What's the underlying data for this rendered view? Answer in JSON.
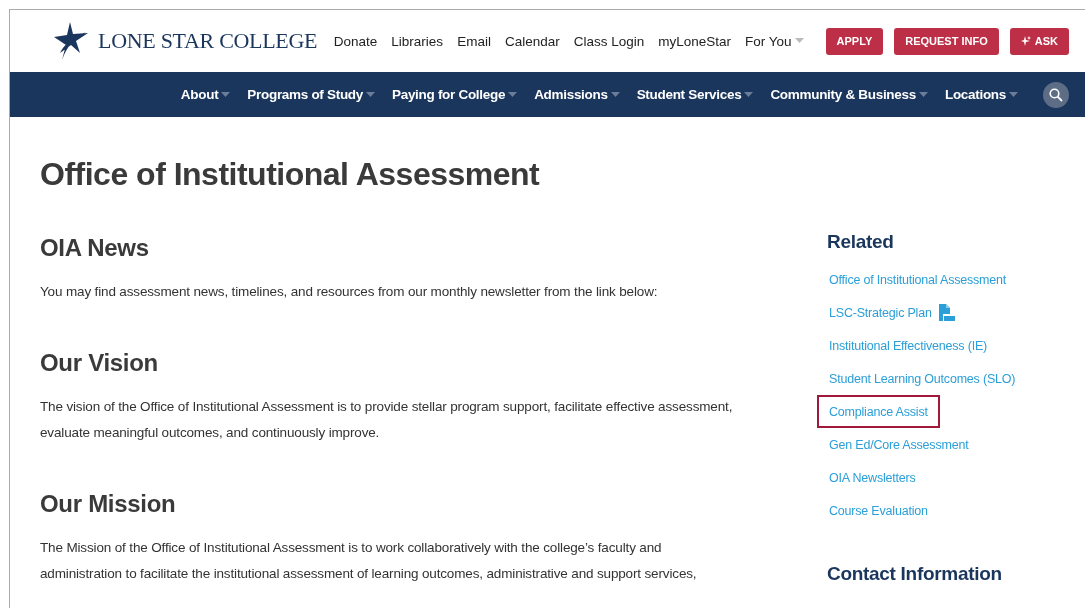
{
  "logo": {
    "text": "LONE STAR COLLEGE"
  },
  "utility_links": [
    {
      "label": "Donate",
      "has_menu": false
    },
    {
      "label": "Libraries",
      "has_menu": false
    },
    {
      "label": "Email",
      "has_menu": false
    },
    {
      "label": "Calendar",
      "has_menu": false
    },
    {
      "label": "Class Login",
      "has_menu": false
    },
    {
      "label": "myLoneStar",
      "has_menu": false
    },
    {
      "label": "For You",
      "has_menu": true
    }
  ],
  "action_buttons": [
    {
      "label": "APPLY",
      "kind": "plain"
    },
    {
      "label": "REQUEST INFO",
      "kind": "plain"
    },
    {
      "label": "ASK",
      "kind": "sparkle"
    }
  ],
  "main_nav": [
    {
      "label": "About",
      "has_menu": true
    },
    {
      "label": "Programs of Study",
      "has_menu": true
    },
    {
      "label": "Paying for College",
      "has_menu": true
    },
    {
      "label": "Admissions",
      "has_menu": true
    },
    {
      "label": "Student Services",
      "has_menu": true
    },
    {
      "label": "Community & Business",
      "has_menu": true
    },
    {
      "label": "Locations",
      "has_menu": true
    }
  ],
  "page_title": "Office of Institutional Assessment",
  "sections": [
    {
      "heading": "OIA News",
      "paragraphs": [
        "You may find assessment news, timelines, and resources from our monthly newsletter from the link below:"
      ]
    },
    {
      "heading": "Our Vision",
      "paragraphs": [
        "The vision of the Office of Institutional Assessment is to provide stellar program support, facilitate effective assessment, evaluate meaningful outcomes, and continuously improve."
      ]
    },
    {
      "heading": "Our Mission",
      "paragraphs": [
        "The Mission of the Office of Institutional Assessment is to work collaboratively with the college’s faculty and administration to facilitate the institutional assessment of learning outcomes, administrative and support services,"
      ]
    }
  ],
  "sidebar": {
    "heading": "Related",
    "links": [
      {
        "label": "Office of Institutional Assessment",
        "pdf": false,
        "highlighted": false
      },
      {
        "label": "LSC-Strategic Plan",
        "pdf": true,
        "highlighted": false
      },
      {
        "label": "Institutional Effectiveness (IE)",
        "pdf": false,
        "highlighted": false
      },
      {
        "label": "Student Learning Outcomes (SLO)",
        "pdf": false,
        "highlighted": false
      },
      {
        "label": "Compliance Assist",
        "pdf": false,
        "highlighted": true
      },
      {
        "label": "Gen Ed/Core Assessment",
        "pdf": false,
        "highlighted": false
      },
      {
        "label": "OIA Newsletters",
        "pdf": false,
        "highlighted": false
      },
      {
        "label": "Course Evaluation",
        "pdf": false,
        "highlighted": false
      }
    ],
    "contact_heading": "Contact Information"
  }
}
